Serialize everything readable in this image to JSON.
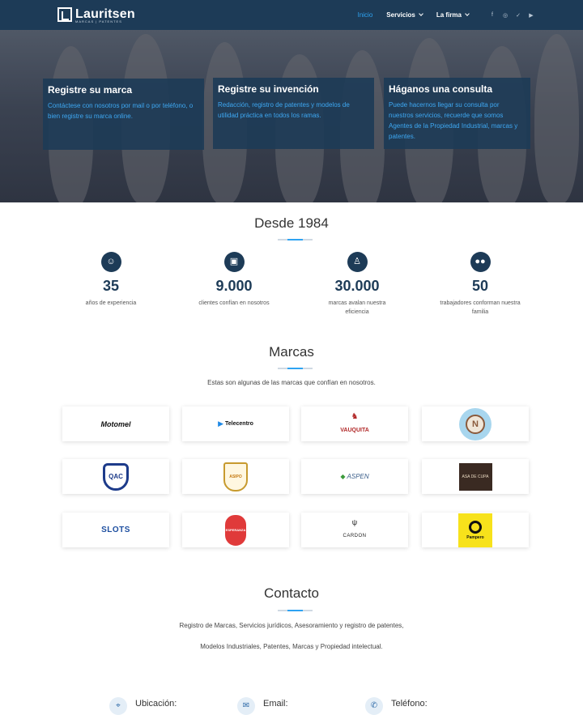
{
  "header": {
    "logo_text": "Lauritsen",
    "logo_sub": "MARCAS | PATENTES",
    "nav": [
      {
        "label": "Inicio",
        "active": true
      },
      {
        "label": "Servicios",
        "dropdown": true
      },
      {
        "label": "La firma",
        "dropdown": true
      }
    ],
    "social_icons": [
      "facebook-icon",
      "instagram-icon",
      "twitter-icon",
      "youtube-icon"
    ]
  },
  "hero": {
    "cards": [
      {
        "title": "Registre su marca",
        "text": "Contáctese con nosotros por mail o por teléfono, o bien registre su marca online."
      },
      {
        "title": "Registre su invención",
        "text": "Redacción, registro de patentes y modelos de utilidad práctica en todos los ramas."
      },
      {
        "title": "Háganos una consulta",
        "text": "Puede hacernos llegar su consulta por nuestros servicios, recuerde que somos Agentes de la Propiedad Industrial, marcas y patentes."
      }
    ]
  },
  "stats": {
    "title": "Desde 1984",
    "items": [
      {
        "icon": "smile-icon",
        "number": "35",
        "label": "años de experiencia"
      },
      {
        "icon": "briefcase-icon",
        "number": "9.000",
        "label": "clientes confían en nosotros"
      },
      {
        "icon": "user-badge-icon",
        "number": "30.000",
        "label": "marcas avalan nuestra eficiencia"
      },
      {
        "icon": "group-icon",
        "number": "50",
        "label": "trabajadores conforman nuestra familia"
      }
    ]
  },
  "brands": {
    "title": "Marcas",
    "subtitle": "Estas son algunas de las marcas que confían en nosotros.",
    "logos": [
      "Motomel",
      "Telecentro",
      "VAUQUITA",
      "N",
      "QAC",
      "ASIPO",
      "ASPEN",
      "ASA DE CUPA",
      "SLOTS",
      "ESPERANZA",
      "CARDON",
      "Pampero"
    ]
  },
  "contact": {
    "title": "Contacto",
    "line1": "Registro de Marcas, Servicios jurídicos, Asesoramiento y registro de patentes,",
    "line2": "Modelos Industriales, Patentes, Marcas y Propiedad intelectual.",
    "items": [
      {
        "icon": "location-icon",
        "label": "Ubicación:"
      },
      {
        "icon": "email-icon",
        "label": "Email:"
      },
      {
        "icon": "phone-icon",
        "label": "Teléfono:"
      }
    ]
  },
  "colors": {
    "navy": "#1d3b57",
    "accent": "#2ea3f2"
  }
}
